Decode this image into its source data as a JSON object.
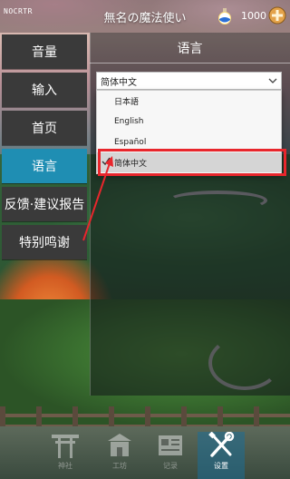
{
  "topbar": {
    "brand": "NOCRTR",
    "title": "無名の魔法使い",
    "coin_count": "1000",
    "potion_icon": "potion-icon",
    "plus_icon": "plus-icon"
  },
  "menu": {
    "items": [
      {
        "label": "音量",
        "active": false
      },
      {
        "label": "输入",
        "active": false
      },
      {
        "label": "首页",
        "active": false
      },
      {
        "label": "语言",
        "active": true
      },
      {
        "label": "反馈·建议报告",
        "active": false
      },
      {
        "label": "特别鸣谢",
        "active": false
      }
    ]
  },
  "language_panel": {
    "title": "语言",
    "selected_value": "简体中文",
    "options": [
      {
        "label": "日本語",
        "selected": false
      },
      {
        "label": "English",
        "selected": false
      },
      {
        "label": "Español",
        "selected": false
      },
      {
        "label": "简体中文",
        "selected": true
      }
    ]
  },
  "bottom_nav": {
    "items": [
      {
        "label": "神社",
        "icon": "torii-icon",
        "active": false
      },
      {
        "label": "工坊",
        "icon": "building-icon",
        "active": false
      },
      {
        "label": "记录",
        "icon": "newspaper-icon",
        "active": false
      },
      {
        "label": "设置",
        "icon": "wrench-screwdriver-icon",
        "active": true
      }
    ]
  },
  "colors": {
    "menu_active": "#1f8eb3",
    "menu_inactive": "#3a3a3a",
    "highlight": "#e8262c"
  }
}
